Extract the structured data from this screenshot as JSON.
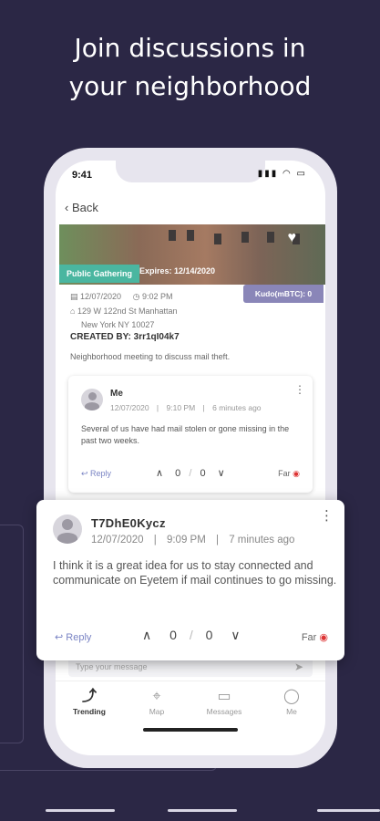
{
  "headline": {
    "line1": "Join discussions in",
    "line2": "your neighborhood"
  },
  "status_bar": {
    "time": "9:41"
  },
  "nav": {
    "back_label": "Back"
  },
  "post": {
    "tag": "Public Gathering",
    "expires": "Expires:  12/14/2020",
    "kudo": "Kudo(mBTC):  0",
    "date": "12/07/2020",
    "time": "9:02 PM",
    "address_line1": "129 W 122nd St Manhattan",
    "address_line2": "New York NY  10027",
    "created_by": "CREATED BY:  3rr1qI04k7",
    "description": "Neighborhood meeting to discuss mail theft."
  },
  "comment1": {
    "author": "Me",
    "date": "12/07/2020",
    "time": "9:10 PM",
    "ago": "6 minutes ago",
    "body": "Several of us have had mail stolen or gone missing in the past two weeks.",
    "reply_label": "Reply",
    "up_count": "0",
    "down_count": "0",
    "distance_label": "Far"
  },
  "comment2": {
    "author": "T7DhE0Kycz",
    "date": "12/07/2020",
    "time": "9:09 PM",
    "ago": "7 minutes ago",
    "body": "I think it is a great idea for us to stay connected and communicate on Eyetem if mail continues to go missing.",
    "reply_label": "Reply",
    "up_count": "0",
    "down_count": "0",
    "distance_label": "Far"
  },
  "message_input": {
    "placeholder": "Type your message"
  },
  "tabs": [
    {
      "label": "Trending",
      "icon": "trending-icon",
      "active": true
    },
    {
      "label": "Map",
      "icon": "map-pin-icon",
      "active": false
    },
    {
      "label": "Messages",
      "icon": "messages-icon",
      "active": false
    },
    {
      "label": "Me",
      "icon": "user-icon",
      "active": false
    }
  ],
  "colors": {
    "background": "#2b2745",
    "tag_public": "#4ab6a0",
    "kudo": "#8a86b8",
    "reply": "#7a84c4"
  }
}
